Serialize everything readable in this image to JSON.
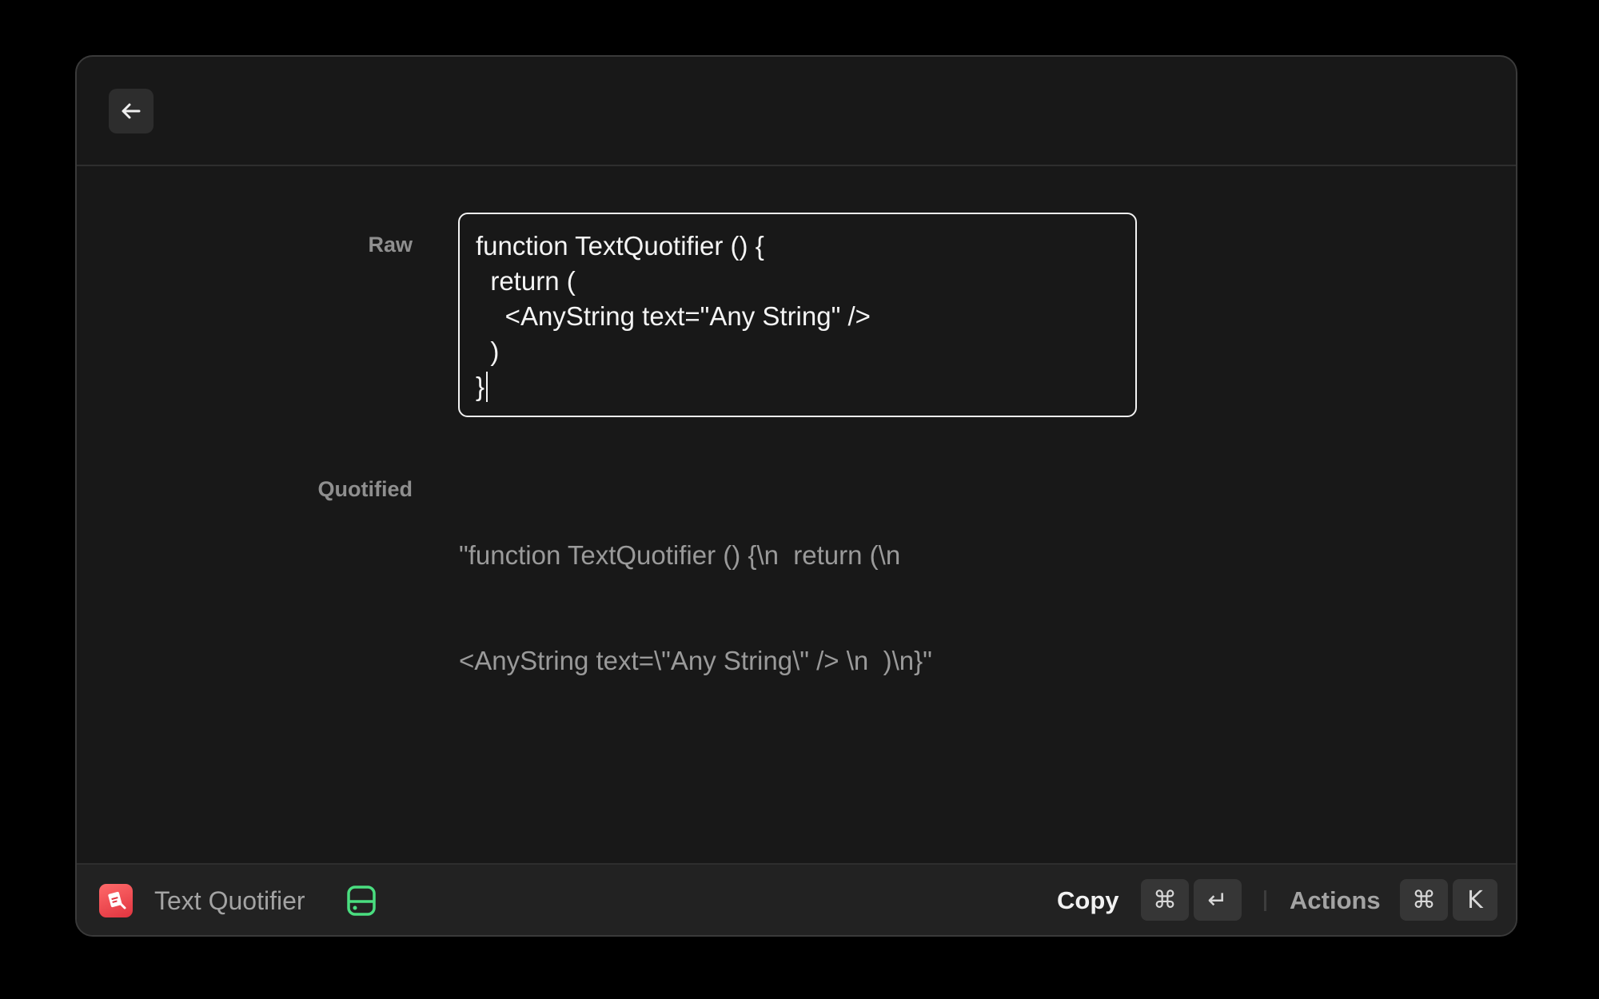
{
  "form": {
    "raw_label": "Raw",
    "raw_lines": [
      "function TextQuotifier () {",
      "  return (",
      "    <AnyString text=\"Any String\" />",
      "  )",
      "}"
    ],
    "quotified_label": "Quotified",
    "quotified_lines": [
      "\"function TextQuotifier () {\\n  return (\\n",
      "<AnyString text=\\\"Any String\\\" /> \\n  )\\n}\""
    ]
  },
  "footer": {
    "app_name": "Text Quotifier",
    "copy_label": "Copy",
    "copy_keys": [
      "⌘",
      "↵"
    ],
    "actions_label": "Actions",
    "actions_keys": [
      "⌘",
      "K"
    ]
  },
  "icons": {
    "back": "arrow-left-icon",
    "app": "text-quotifier-app-icon",
    "storage": "hard-drive-icon"
  },
  "colors": {
    "window_bg": "#181818",
    "footer_bg": "#222222",
    "accent_green": "#4ade80",
    "app_red": "#ef4444"
  }
}
